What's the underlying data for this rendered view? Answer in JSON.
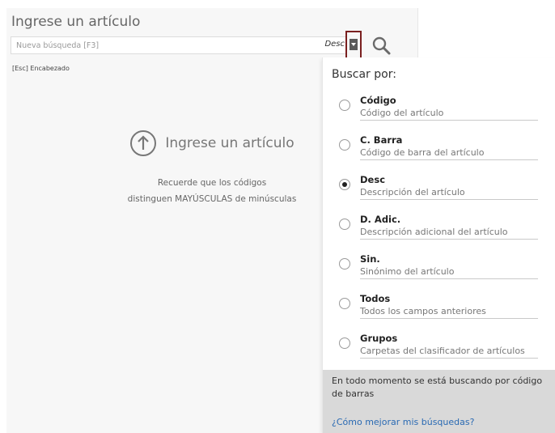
{
  "panel": {
    "title": "Ingrese un artículo",
    "search_placeholder": "Nueva búsqueda [F3]",
    "search_mode": "Desc",
    "hint": "[Esc]  Encabezado"
  },
  "empty_state": {
    "title": "Ingrese un artículo",
    "line1": "Recuerde que los códigos",
    "line2": "distinguen MAYÚSCULAS de minúsculas",
    "icon": "arrow-up-circle-icon"
  },
  "search_options": {
    "header": "Buscar por:",
    "selected": "Desc",
    "items": [
      {
        "label": "Código",
        "desc": "Código del artículo",
        "checked": false
      },
      {
        "label": "C. Barra",
        "desc": "Código de barra del artículo",
        "checked": false
      },
      {
        "label": "Desc",
        "desc": "Descripción del artículo",
        "checked": true
      },
      {
        "label": "D. Adic.",
        "desc": "Descripción adicional del artículo",
        "checked": false
      },
      {
        "label": "Sin.",
        "desc": "Sinónimo del artículo",
        "checked": false
      },
      {
        "label": "Todos",
        "desc": "Todos los campos anteriores",
        "checked": false
      },
      {
        "label": "Grupos",
        "desc": "Carpetas del clasificador de artículos",
        "checked": false
      }
    ],
    "footer_note": "En todo momento se está buscando por código de barras",
    "help_link": "¿Cómo mejorar mis búsquedas?"
  },
  "colors": {
    "dropdown_border": "#7a1f1f",
    "link": "#2a6ab3",
    "footer_bg": "#d9d9d9"
  }
}
